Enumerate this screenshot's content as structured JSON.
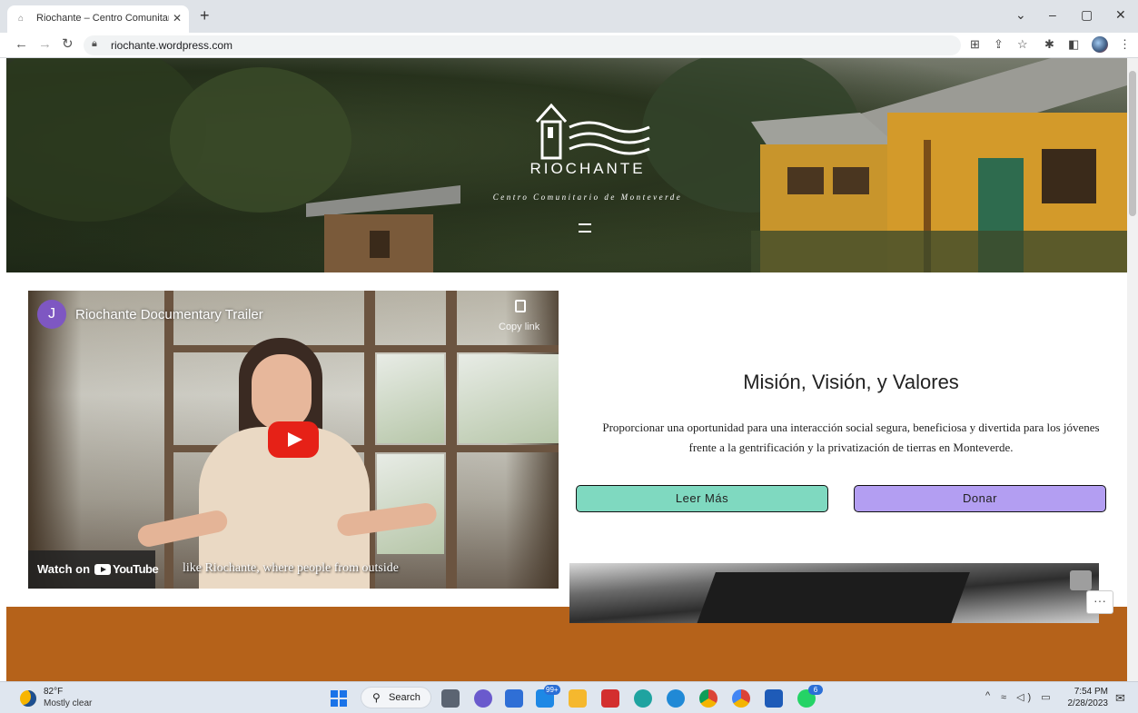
{
  "browser": {
    "tab_title": "Riochante – Centro Comunitario",
    "tab_close": "✕",
    "new_tab": "+",
    "url": "riochante.wordpress.com",
    "window_controls": {
      "dropdown": "⌄",
      "minimize": "–",
      "restore": "▢",
      "close": "✕"
    }
  },
  "hero": {
    "brand": "RIOCHANTE",
    "subtitle": "Centro Comunitario de Monteverde"
  },
  "video": {
    "avatar_letter": "J",
    "title": "Riochante Documentary Trailer",
    "copy_label": "Copy link",
    "watch_on": "Watch on",
    "youtube": "YouTube",
    "caption": "like Riochante, where people from outside"
  },
  "mission": {
    "title": "Misión, Visión, y Valores",
    "text": "Proporcionar una oportunidad para una interacción social segura, beneficiosa y divertida para los jóvenes frente a la gentrificación y la privatización de tierras en Monteverde.",
    "button_more": "Leer Más",
    "button_donate": "Donar",
    "colors": {
      "more": "#7fd9c0",
      "donate": "#b39ef2",
      "band": "#b5621a"
    }
  },
  "page_widgets": {
    "more_button": "···"
  },
  "taskbar": {
    "temperature": "82°F",
    "weather": "Mostly clear",
    "search": "Search",
    "badge_mail": "99+",
    "badge_whatsapp": "6",
    "time": "7:54 PM",
    "date": "2/28/2023"
  }
}
